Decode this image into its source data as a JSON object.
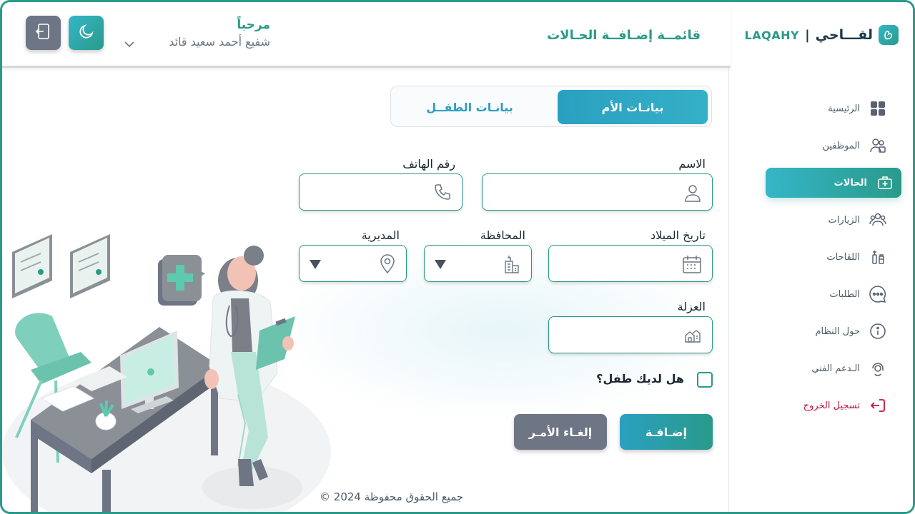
{
  "brand": {
    "name_ar": "لقـــاحي",
    "separator": "|",
    "name_en": "LAQAHY"
  },
  "header": {
    "page_title": "قائمــة إضـافــة الحـالات",
    "welcome": "مرحباً",
    "user_name": "شفيع أحمد سعيد قائد"
  },
  "sidebar": {
    "items": [
      {
        "label": "الرئيسية",
        "icon": "grid-icon"
      },
      {
        "label": "الموظفين",
        "icon": "users-icon"
      },
      {
        "label": "الحالات",
        "icon": "medical-kit-icon",
        "active": true
      },
      {
        "label": "الزيارات",
        "icon": "group-icon"
      },
      {
        "label": "اللقاحات",
        "icon": "vaccine-icon"
      },
      {
        "label": "الطلبات",
        "icon": "chat-icon"
      },
      {
        "label": "حول النظام",
        "icon": "info-icon"
      },
      {
        "label": "الـدعم الفني",
        "icon": "support-icon"
      },
      {
        "label": "تسجيل الخروج",
        "icon": "logout-icon"
      }
    ]
  },
  "tabs": {
    "mother": "بيانـات الأم",
    "child": "بيانـات الطفــل"
  },
  "form": {
    "name_label": "الاسم",
    "phone_label": "رقم الهاتف",
    "birthdate_label": "تاريخ الميلاد",
    "governorate_label": "المحافظة",
    "directorate_label": "المديرية",
    "isolation_label": "العزلة",
    "has_child_label": "هل لديك طفل؟",
    "add_button": "إضـافـة",
    "cancel_button": "إلغـاء الأمـر"
  },
  "footer": {
    "copyright": "جميع الحقوق محفوظة 2024 ©"
  },
  "colors": {
    "primary": "#2a9a8a",
    "accent": "#2aa0c0",
    "muted": "#6e7585",
    "danger": "#c0143c"
  }
}
